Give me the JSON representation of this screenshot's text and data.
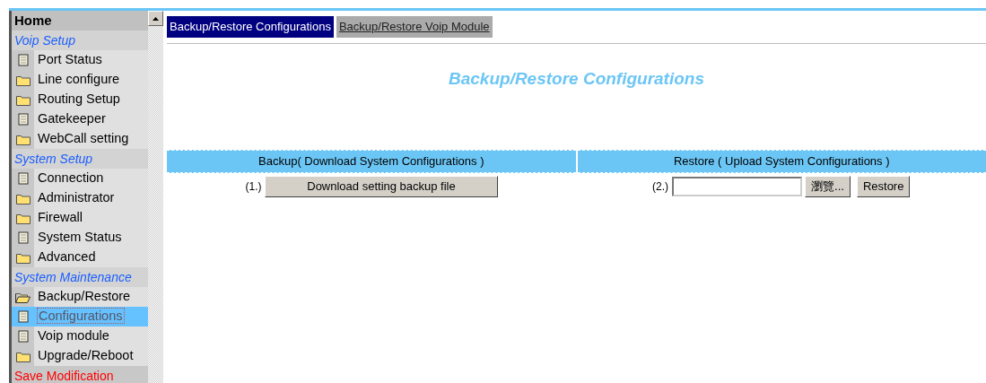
{
  "sidebar": {
    "items": [
      {
        "kind": "home",
        "label": "Home"
      },
      {
        "kind": "section",
        "label": "Voip Setup"
      },
      {
        "kind": "page",
        "label": "Port Status"
      },
      {
        "kind": "folder",
        "label": "Line configure"
      },
      {
        "kind": "folder",
        "label": "Routing Setup"
      },
      {
        "kind": "page",
        "label": "Gatekeeper"
      },
      {
        "kind": "folder",
        "label": "WebCall setting"
      },
      {
        "kind": "section",
        "label": "System Setup"
      },
      {
        "kind": "page",
        "label": "Connection"
      },
      {
        "kind": "folder",
        "label": "Administrator"
      },
      {
        "kind": "folder",
        "label": "Firewall"
      },
      {
        "kind": "page",
        "label": "System Status"
      },
      {
        "kind": "folder",
        "label": "Advanced"
      },
      {
        "kind": "section",
        "label": "System Maintenance"
      },
      {
        "kind": "folder",
        "expanded": true,
        "label": "Backup/Restore",
        "children": [
          {
            "label": "Configurations",
            "selected": true,
            "focused": true
          },
          {
            "label": "Voip module",
            "selected": false,
            "focused": false
          }
        ]
      },
      {
        "kind": "folder",
        "expanded": false,
        "label": "Upgrade/Reboot"
      },
      {
        "kind": "action",
        "label": "Save Modification"
      }
    ]
  },
  "tabs": [
    {
      "label": "Backup/Restore Configurations",
      "selected": true
    },
    {
      "label": "Backup/Restore Voip Module",
      "selected": false
    }
  ],
  "page_title": "Backup/Restore Configurations",
  "backup": {
    "heading": "Backup( Download System Configurations )",
    "step": "(1.)",
    "button": "Download setting backup file"
  },
  "restore": {
    "heading": "Restore ( Upload System Configurations )",
    "step": "(2.)",
    "browse_button": "瀏覽...",
    "button": "Restore"
  }
}
